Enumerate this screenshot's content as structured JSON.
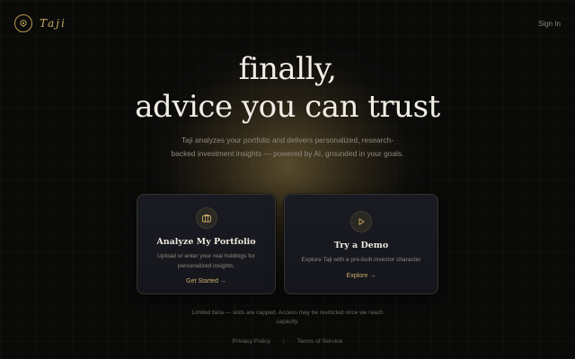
{
  "brand": {
    "name": "Taji",
    "logo_icon": "lion-crest-icon",
    "accent": "#c9ad6a"
  },
  "header": {
    "signin_label": "Sign In"
  },
  "hero": {
    "title_line1": "finally,",
    "title_line2": "advice you can trust",
    "subtitle": "Taji analyzes your portfolio and delivers personalized, research-backed investment insights — powered by AI, grounded in your goals."
  },
  "cards": [
    {
      "icon": "briefcase-icon",
      "title": "Analyze My Portfolio",
      "description": "Upload or enter your real holdings for personalized insights.",
      "link": "Get Started →"
    },
    {
      "icon": "play-icon",
      "title": "Try a Demo",
      "description": "Explore Taji with a pre-built investor character",
      "link": "Explore →"
    }
  ],
  "notice": "Limited beta — slots are capped. Access may be restricted once we reach capacity.",
  "footer": {
    "privacy": "Privacy Policy",
    "separator": "|",
    "terms": "Terms of Service"
  }
}
